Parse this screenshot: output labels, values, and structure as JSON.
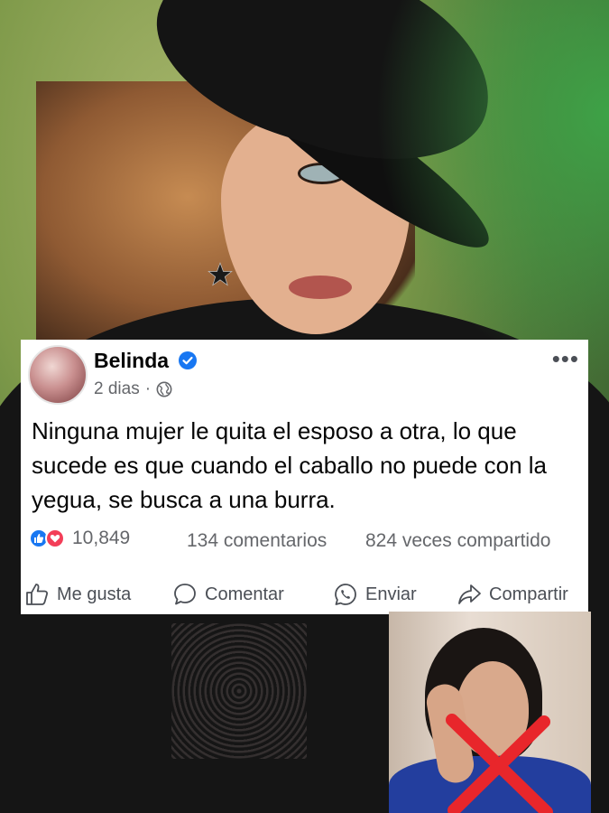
{
  "post": {
    "author": "Belinda",
    "verified": true,
    "time": "2 dias",
    "separator": "·",
    "privacy_icon": "globe-icon",
    "more_label": "•••",
    "text": "Ninguna mujer le quita el esposo a otra, lo que sucede es que cuando el caballo no puede con la yegua, se busca a una burra.",
    "reactions": {
      "count": "10,849",
      "icons": [
        "like-icon",
        "love-icon"
      ]
    },
    "comments": "134 comentarios",
    "shares": "824 veces compartido",
    "actions": [
      {
        "label": "Me gusta",
        "icon": "thumbs-up-icon"
      },
      {
        "label": "Comentar",
        "icon": "comment-icon"
      },
      {
        "label": "Enviar",
        "icon": "whatsapp-icon"
      },
      {
        "label": "Compartir",
        "icon": "share-icon"
      }
    ]
  },
  "colors": {
    "facebook_blue": "#1877f2",
    "love_red": "#f33e58",
    "cross_red": "#e8262b"
  }
}
